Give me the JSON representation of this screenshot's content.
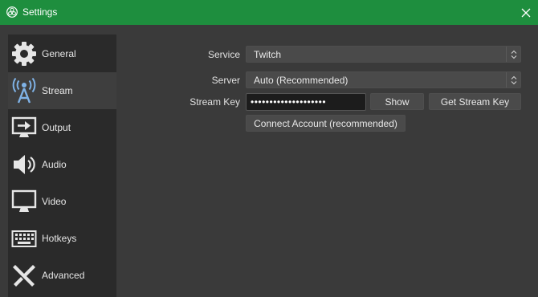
{
  "window": {
    "title": "Settings"
  },
  "sidebar": {
    "items": [
      {
        "label": "General",
        "icon": "gear-icon",
        "active": false
      },
      {
        "label": "Stream",
        "icon": "broadcast-antenna-icon",
        "active": true
      },
      {
        "label": "Output",
        "icon": "output-monitor-icon",
        "active": false
      },
      {
        "label": "Audio",
        "icon": "speaker-icon",
        "active": false
      },
      {
        "label": "Video",
        "icon": "monitor-icon",
        "active": false
      },
      {
        "label": "Hotkeys",
        "icon": "keyboard-icon",
        "active": false
      },
      {
        "label": "Advanced",
        "icon": "tools-icon",
        "active": false
      }
    ]
  },
  "stream": {
    "service_label": "Service",
    "service_value": "Twitch",
    "server_label": "Server",
    "server_value": "Auto (Recommended)",
    "key_label": "Stream Key",
    "key_value": "••••••••••••••••••••",
    "show_label": "Show",
    "get_key_label": "Get Stream Key",
    "connect_label": "Connect Account (recommended)"
  },
  "colors": {
    "titlebar": "#1e8e3e",
    "sidebar": "#2a2a2a",
    "content": "#3a3a3a",
    "active_item": "#3e3e3e"
  }
}
